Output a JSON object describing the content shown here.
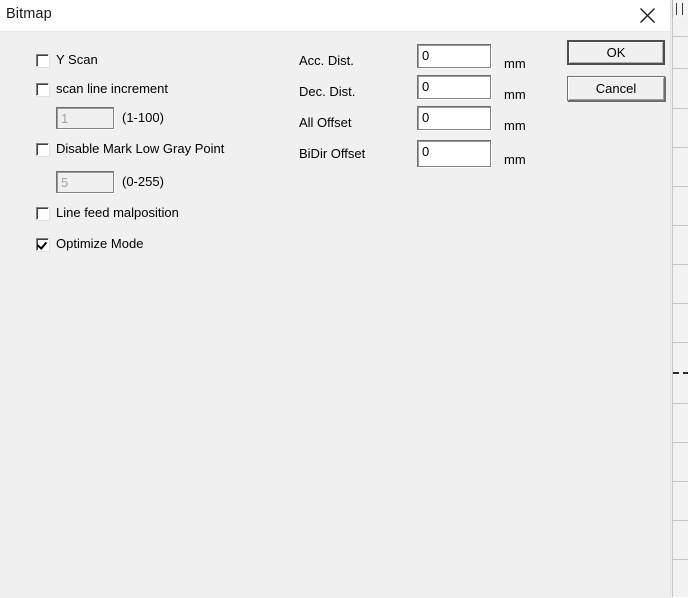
{
  "window": {
    "title": "Bitmap",
    "close_icon": "close-icon"
  },
  "checkboxes": [
    {
      "label": "Y Scan",
      "checked": false
    },
    {
      "label": "scan line increment",
      "checked": false
    },
    {
      "label": "Disable Mark Low Gray Point",
      "checked": false
    },
    {
      "label": "Line feed malposition",
      "checked": false
    },
    {
      "label": "Optimize Mode",
      "checked": true
    }
  ],
  "numeric_inputs": [
    {
      "name": "scan-line-increment",
      "value": "1",
      "range_label": "(1-100)",
      "enabled": false
    },
    {
      "name": "low-gray-point",
      "value": "5",
      "range_label": "(0-255)",
      "enabled": false
    }
  ],
  "distance_fields": [
    {
      "label": "Acc. Dist.",
      "value": "0",
      "unit": "mm"
    },
    {
      "label": "Dec. Dist.",
      "value": "0",
      "unit": "mm"
    },
    {
      "label": "All Offset",
      "value": "0",
      "unit": "mm"
    },
    {
      "label": "BiDir Offset",
      "value": "0",
      "unit": "mm"
    }
  ],
  "buttons": {
    "ok": "OK",
    "cancel": "Cancel"
  },
  "colors": {
    "dialog_face": "#f0f0f0",
    "titlebar": "#ffffff",
    "text": "#000000",
    "disabled_text": "#a6a6a6",
    "field_bg": "#ffffff"
  }
}
